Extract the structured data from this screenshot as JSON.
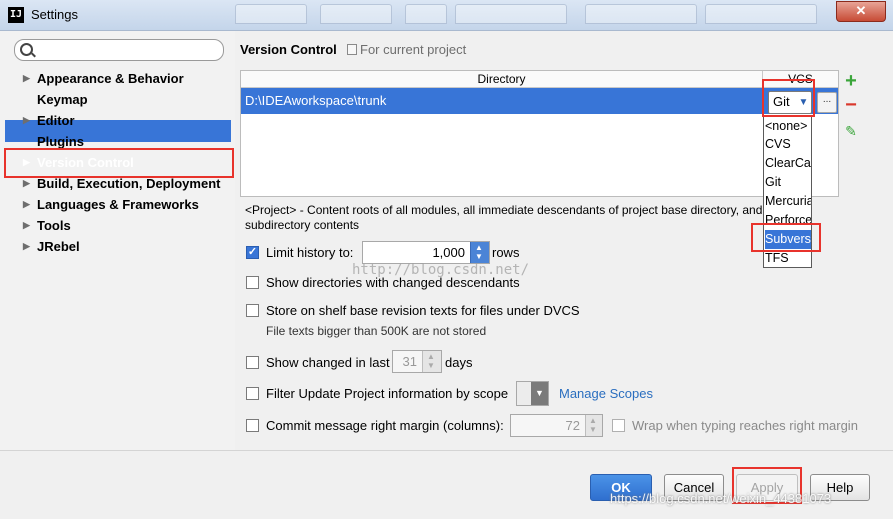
{
  "window": {
    "title": "Settings",
    "app_icon": "IJ",
    "close": "✕"
  },
  "search": {
    "placeholder": ""
  },
  "nav": {
    "items": [
      {
        "label": "Appearance & Behavior",
        "arrow": "▶"
      },
      {
        "label": "Keymap",
        "arrow": ""
      },
      {
        "label": "Editor",
        "arrow": "▶"
      },
      {
        "label": "Plugins",
        "arrow": ""
      },
      {
        "label": "Version Control",
        "arrow": "▶"
      },
      {
        "label": "Build, Execution, Deployment",
        "arrow": "▶"
      },
      {
        "label": "Languages & Frameworks",
        "arrow": "▶"
      },
      {
        "label": "Tools",
        "arrow": "▶"
      },
      {
        "label": "JRebel",
        "arrow": "▶"
      }
    ],
    "selected_index": 4
  },
  "main": {
    "title": "Version Control",
    "scope_note": "For current project",
    "table": {
      "headers": [
        "Directory",
        "VCS"
      ],
      "rows": [
        {
          "directory": "D:\\IDEAworkspace\\trunk",
          "vcs": "Git"
        }
      ],
      "more_button": "...",
      "add": "+",
      "remove": "−",
      "edit": "✎"
    },
    "vcs_dropdown": {
      "options": [
        "<none>",
        "CVS",
        "ClearCase",
        "Git",
        "Mercurial",
        "Perforce",
        "Subversion",
        "TFS"
      ],
      "highlighted": "Subversion"
    },
    "description": "<Project> - Content roots of all modules, all immediate descendants of project base directory, and its subdirectory contents",
    "options": {
      "limit_history": {
        "label": "Limit history to:",
        "checked": true,
        "value": "1,000",
        "suffix": "rows"
      },
      "show_dirs": {
        "label": "Show directories with changed descendants",
        "checked": false
      },
      "store_shelf": {
        "label": "Store on shelf base revision texts for files under DVCS",
        "checked": false,
        "note": "File texts bigger than 500K are not stored"
      },
      "show_changed": {
        "label": "Show changed in last",
        "checked": false,
        "value": "31",
        "suffix": "days"
      },
      "filter_update": {
        "label": "Filter Update Project information by scope",
        "checked": false,
        "link": "Manage Scopes"
      },
      "commit_margin": {
        "label": "Commit message right margin (columns):",
        "checked": false,
        "value": "72",
        "wrap_label": "Wrap when typing reaches right margin"
      }
    }
  },
  "buttons": {
    "ok": "OK",
    "cancel": "Cancel",
    "apply": "Apply",
    "help": "Help"
  },
  "watermarks": {
    "center": "http://blog.csdn.net/",
    "bottom": "https://blog.csdn.net/weixin_44381073"
  },
  "colors": {
    "selection": "#3875d7",
    "highlight_box": "#e8332c",
    "link": "#2a6ebf"
  }
}
